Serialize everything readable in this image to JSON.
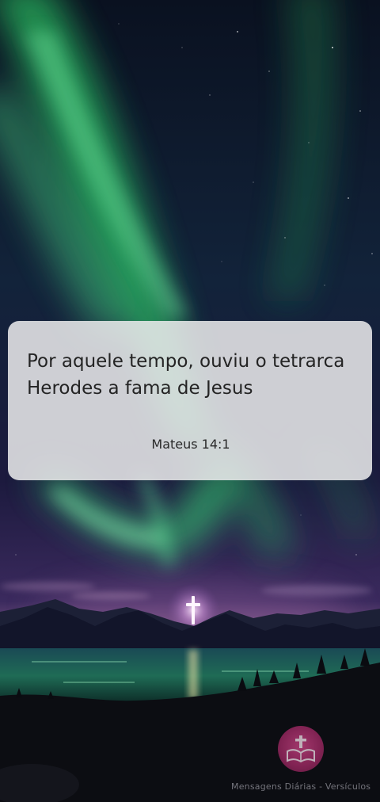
{
  "verse": {
    "text": "Por aquele tempo, ouviu o tetrarca Herodes a fama de Jesus",
    "reference": "Mateus 14:1"
  },
  "branding": {
    "logo_icon": "bible-cross-logo-icon",
    "caption": "Mensagens Diárias - Versículos"
  },
  "colors": {
    "card_background": "#ECECEE",
    "text": "#242424",
    "logo": "#C23A7C",
    "aurora": "#3FE07A"
  }
}
